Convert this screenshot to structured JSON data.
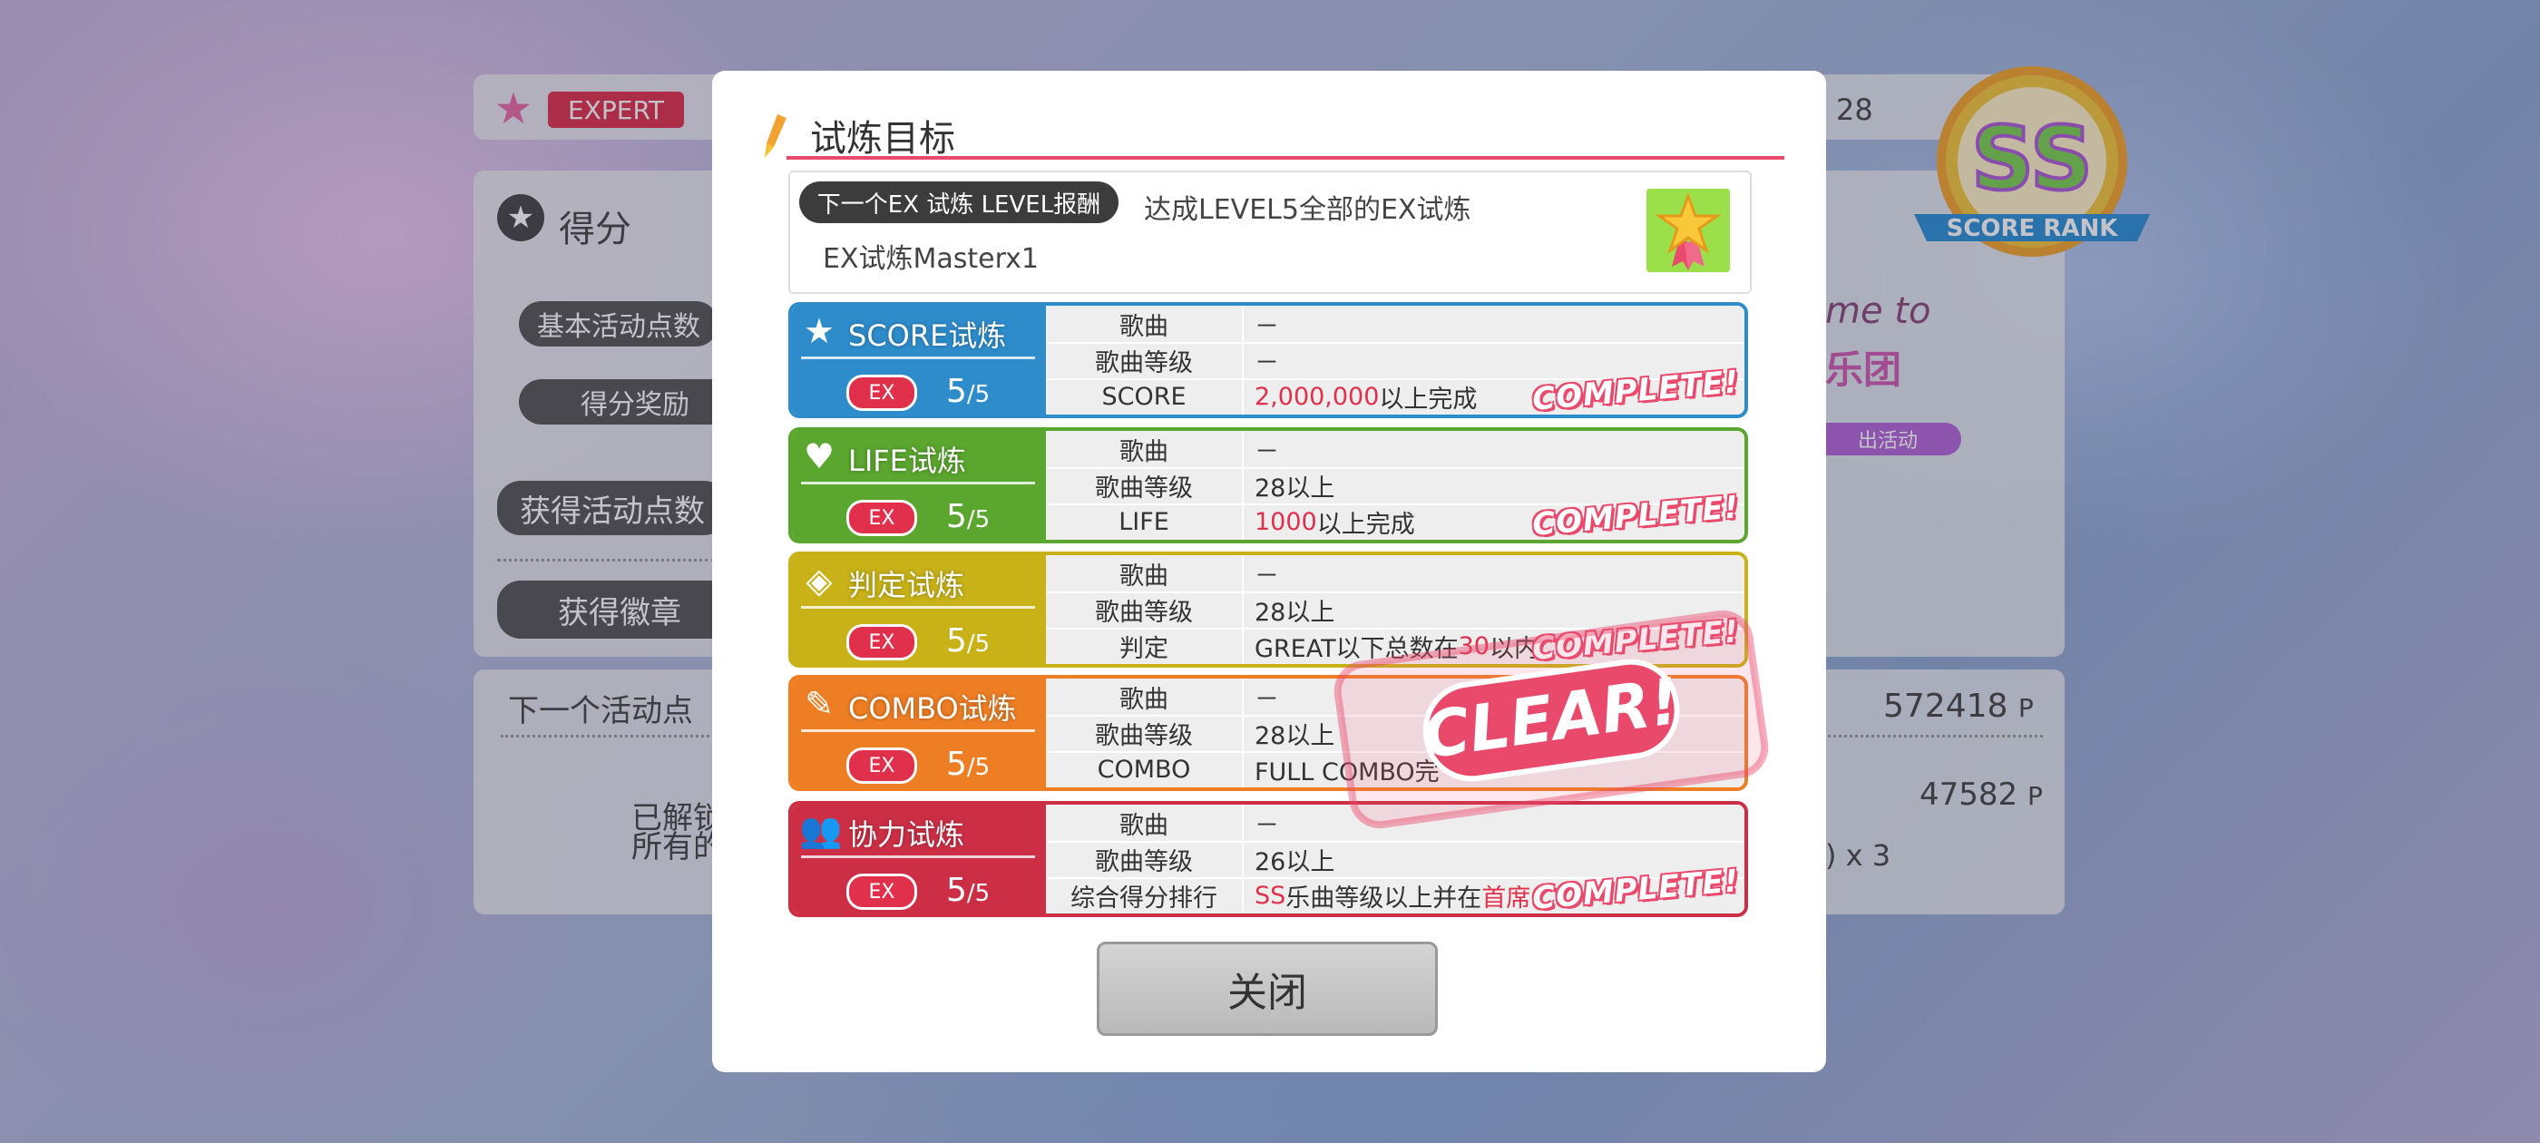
{
  "background": {
    "difficulty": "EXPERT",
    "level_value": "28",
    "score_label": "得分",
    "basic_points_label": "基本活动点数",
    "score_bonus_label": "得分奖励",
    "gain_points_label": "获得活动点数",
    "gain_badge_label": "获得徽章",
    "next_points_label": "下一个活动点",
    "next_points_value": "572418",
    "points_unit": "P",
    "second_value": "47582",
    "unlocked_line1": "已解锁",
    "unlocked_line2": "所有的",
    "multiplier_text": ") x 3",
    "event_logo_text": "me to",
    "event_logo_sub": "乐团",
    "event_label": "出活动",
    "rank_letters": "SS",
    "rank_label": "SCORE RANK"
  },
  "modal": {
    "title": "试炼目标",
    "reward_pill": "下一个EX 试炼 LEVEL报酬",
    "reward_desc": "达成LEVEL5全部的EX试炼",
    "reward_item": "EX试炼Masterx1",
    "close_label": "关闭",
    "clear_stamp": "CLEAR!",
    "colors": {
      "score": "#2e8ccb",
      "life": "#5aa62e",
      "judge": "#c8b218",
      "combo": "#ee7e24",
      "coop": "#cc2f45",
      "accent": "#e94a6c"
    },
    "trials": [
      {
        "name": "SCORE试炼",
        "icon": "star-icon",
        "ex": "EX",
        "count": "5",
        "total": "/5",
        "rows": [
          {
            "key": "歌曲",
            "val": "－"
          },
          {
            "key": "歌曲等级",
            "val": "－"
          },
          {
            "key": "SCORE",
            "val_red": "2,000,000",
            "val": "以上完成"
          }
        ],
        "complete": "COMPLETE!"
      },
      {
        "name": "LIFE试炼",
        "icon": "heart-icon",
        "ex": "EX",
        "count": "5",
        "total": "/5",
        "rows": [
          {
            "key": "歌曲",
            "val": "－"
          },
          {
            "key": "歌曲等级",
            "val": "28以上"
          },
          {
            "key": "LIFE",
            "val_red": "1000",
            "val": "以上完成"
          }
        ],
        "complete": "COMPLETE!"
      },
      {
        "name": "判定试炼",
        "icon": "diamond-icon",
        "ex": "EX",
        "count": "5",
        "total": "/5",
        "rows": [
          {
            "key": "歌曲",
            "val": "－"
          },
          {
            "key": "歌曲等级",
            "val": "28以上"
          },
          {
            "key": "判定",
            "val": "GREAT以下总数在",
            "val_red": "30",
            "val2": "以内"
          }
        ],
        "complete": "COMPLETE!"
      },
      {
        "name": "COMBO试炼",
        "icon": "pen-icon",
        "ex": "EX",
        "count": "5",
        "total": "/5",
        "rows": [
          {
            "key": "歌曲",
            "val": "－"
          },
          {
            "key": "歌曲等级",
            "val": "28以上"
          },
          {
            "key": "COMBO",
            "val": "FULL COMBO完"
          }
        ]
      },
      {
        "name": "协力试炼",
        "icon": "people-icon",
        "ex": "EX",
        "count": "5",
        "total": "/5",
        "rows": [
          {
            "key": "歌曲",
            "val": "－"
          },
          {
            "key": "歌曲等级",
            "val": "26以上"
          },
          {
            "key": "综合得分排行",
            "val_red": "SS",
            "val": "乐曲等级以上并在",
            "val_red2": "首席"
          }
        ],
        "complete": "COMPLETE!"
      }
    ]
  }
}
